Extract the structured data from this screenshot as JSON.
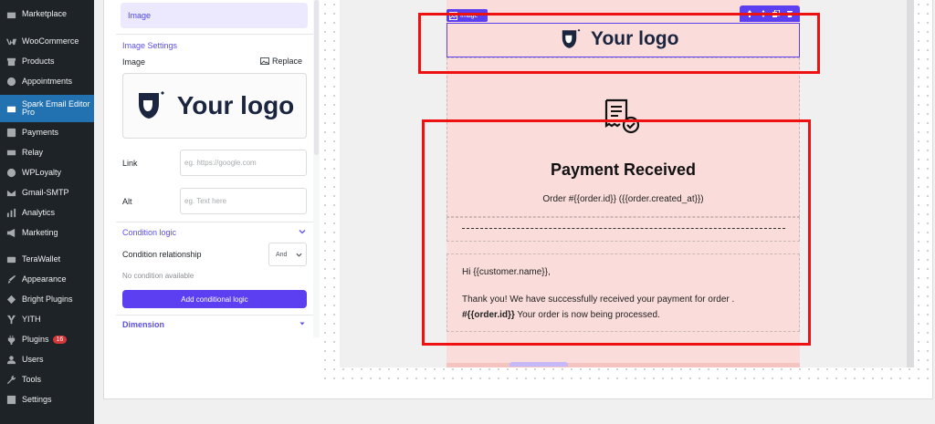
{
  "sidebar": {
    "items": [
      {
        "label": "Marketplace",
        "icon": "store-icon"
      },
      {
        "label": "WooCommerce",
        "icon": "woo-icon"
      },
      {
        "label": "Products",
        "icon": "archive-icon"
      },
      {
        "label": "Appointments",
        "icon": "clock-icon"
      },
      {
        "label": "Spark Email Editor Pro",
        "icon": "email-editor-icon"
      },
      {
        "label": "Payments",
        "icon": "dollar-icon"
      },
      {
        "label": "Relay",
        "icon": "relay-icon"
      },
      {
        "label": "WPLoyalty",
        "icon": "loyalty-icon"
      },
      {
        "label": "Gmail-SMTP",
        "icon": "mail-icon"
      },
      {
        "label": "Analytics",
        "icon": "bar-chart-icon"
      },
      {
        "label": "Marketing",
        "icon": "megaphone-icon"
      },
      {
        "label": "TeraWallet",
        "icon": "wallet-icon"
      },
      {
        "label": "Appearance",
        "icon": "brush-icon"
      },
      {
        "label": "Bright Plugins",
        "icon": "bright-plugins-icon"
      },
      {
        "label": "YITH",
        "icon": "yith-icon"
      },
      {
        "label": "Plugins",
        "icon": "plugin-icon",
        "badge": "16"
      },
      {
        "label": "Users",
        "icon": "users-icon"
      },
      {
        "label": "Tools",
        "icon": "wrench-icon"
      },
      {
        "label": "Settings",
        "icon": "settings-icon"
      }
    ]
  },
  "settings": {
    "tab_label": "Image",
    "image_settings_title": "Image Settings",
    "image_label": "Image",
    "replace_label": "Replace",
    "preview_logo_text": "Your logo",
    "link_label": "Link",
    "link_placeholder": "eg. https://google.com",
    "alt_label": "Alt",
    "alt_placeholder": "eg. Text here",
    "condition_logic_title": "Condition logic",
    "condition_relationship_label": "Condition relationship",
    "condition_relationship_value": "And",
    "no_condition_text": "No condition available",
    "add_condition_button": "Add conditional logic",
    "dimension_title": "Dimension"
  },
  "email": {
    "chip_label": "Image",
    "logo_text": "Your logo",
    "title": "Payment Received",
    "subtitle": "Order #{{order.id}} ({{order.created_at}})",
    "greeting": "Hi {{customer.name}},",
    "body_line1": "Thank you! We have successfully received your payment for order .",
    "order_ref": "#{{order.id}}",
    "body_line2_rest": " Your order is now being processed."
  },
  "colors": {
    "accent": "#5b3ff0",
    "email_background": "#fadcda",
    "wp_sidebar": "#1d2327",
    "wp_active": "#2271b1",
    "highlight_box": "#ee1111"
  }
}
